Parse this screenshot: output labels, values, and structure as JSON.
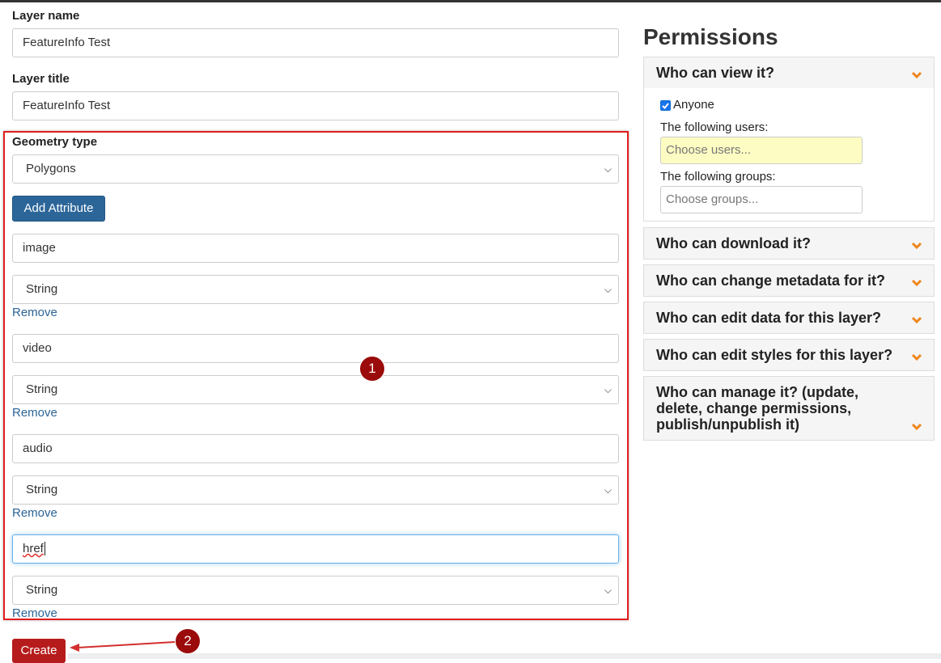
{
  "form": {
    "layer_name_label": "Layer name",
    "layer_name_value": "FeatureInfo Test",
    "layer_title_label": "Layer title",
    "layer_title_value": "FeatureInfo Test",
    "geometry_label": "Geometry type",
    "geometry_value": "Polygons",
    "add_attribute_label": "Add Attribute",
    "attributes": [
      {
        "name": "image",
        "type": "String",
        "remove": "Remove"
      },
      {
        "name": "video",
        "type": "String",
        "remove": "Remove"
      },
      {
        "name": "audio",
        "type": "String",
        "remove": "Remove"
      },
      {
        "name": "href",
        "type": "String",
        "remove": "Remove"
      }
    ],
    "create_label": "Create"
  },
  "annotations": {
    "badge1": "1",
    "badge2": "2",
    "highlight_color": "#e01e1e",
    "badge_color": "#9b0b0b"
  },
  "permissions": {
    "title": "Permissions",
    "view": {
      "header": "Who can view it?",
      "anyone_label": "Anyone",
      "anyone_checked": true,
      "users_label": "The following users:",
      "users_placeholder": "Choose users...",
      "groups_label": "The following groups:",
      "groups_placeholder": "Choose groups..."
    },
    "download_header": "Who can download it?",
    "metadata_header": "Who can change metadata for it?",
    "edit_data_header": "Who can edit data for this layer?",
    "edit_styles_header": "Who can edit styles for this layer?",
    "manage_header": "Who can manage it? (update, delete, change permissions, publish/unpublish it)",
    "chevron_icon": "chevron-down-icon",
    "chevron_color": "#f0861c"
  },
  "colors": {
    "primary_button": "#2c6699",
    "danger_button": "#b71c1c",
    "link": "#2a6496"
  }
}
